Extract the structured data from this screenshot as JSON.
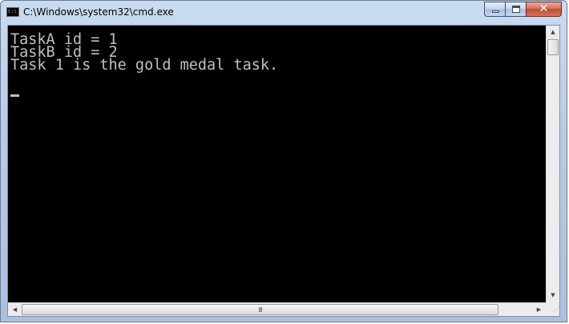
{
  "window": {
    "title": "C:\\Windows\\system32\\cmd.exe",
    "app_icon_text": "C:\\"
  },
  "caption_buttons": {
    "minimize": "minimize",
    "maximize": "maximize",
    "close": "✕"
  },
  "console": {
    "lines": [
      "TaskA id = 1",
      "TaskB id = 2",
      "Task 1 is the gold medal task."
    ],
    "text_color": "#c0c0c0",
    "background_color": "#000000"
  },
  "scrollbars": {
    "up_arrow": "▲",
    "down_arrow": "▼",
    "left_arrow": "◀",
    "right_arrow": "▶",
    "grip": "III",
    "size_grip": "⋰"
  }
}
